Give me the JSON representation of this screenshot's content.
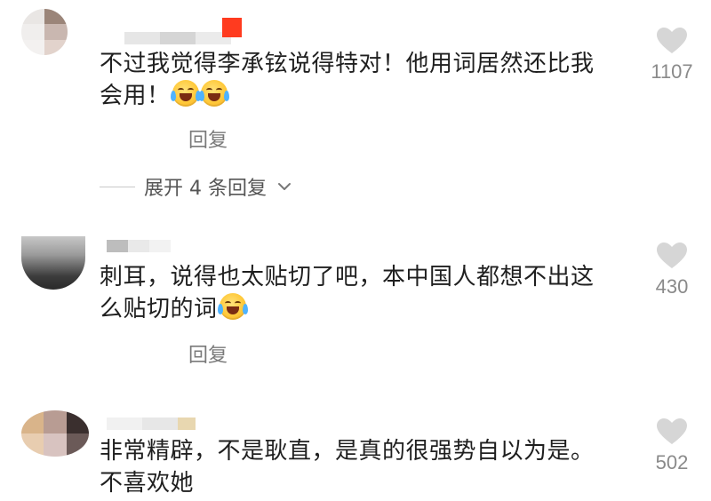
{
  "comments": [
    {
      "text": "不过我觉得李承铉说得特对！他用词居然还比我会用！",
      "emoji": [
        "grinning-squinting-tears-face",
        "grinning-squinting-tears-face"
      ],
      "likes": "1107",
      "reply_label": "回复",
      "expand_label": "展开 4 条回复"
    },
    {
      "text": "刺耳，说得也太贴切了吧，本中国人都想不出这么贴切的词",
      "emoji": [
        "loudly-crying-face"
      ],
      "likes": "430",
      "reply_label": "回复"
    },
    {
      "text": "非常精辟，不是耿直，是真的很强势自以为是。不喜欢她",
      "emoji": [],
      "likes": "502"
    }
  ],
  "colors": {
    "like_gray": "#d6d6d6",
    "badge_red": "#ff3b1f",
    "secondary_text": "#7a7a7a"
  },
  "icons": {
    "like": "heart-icon",
    "expand": "chevron-down-icon"
  }
}
